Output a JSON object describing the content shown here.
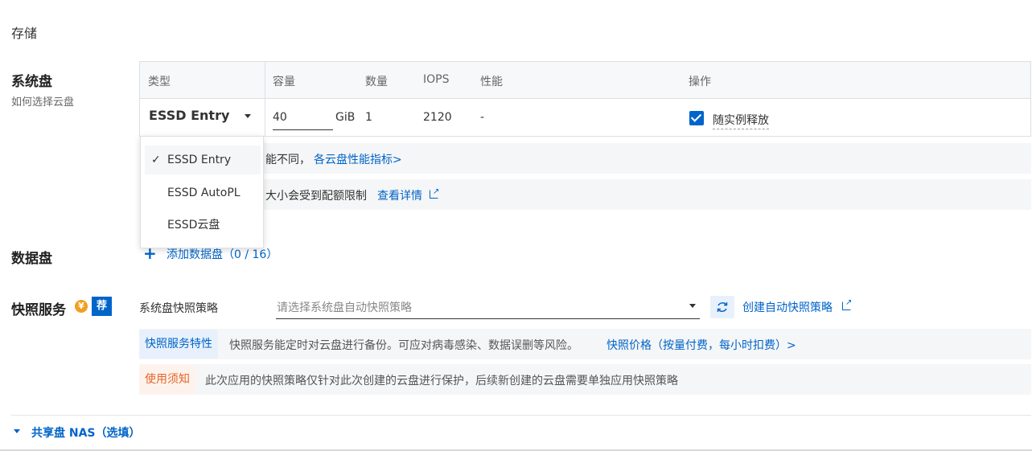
{
  "page": {
    "section_label": "存储"
  },
  "system_disk": {
    "title": "系统盘",
    "help_link": "如何选择云盘",
    "table": {
      "headers": [
        "类型",
        "容量",
        "数量",
        "IOPS",
        "性能",
        "操作"
      ],
      "row": {
        "type": "ESSD Entry",
        "capacity": "40",
        "capacity_unit": "GiB",
        "quantity": "1",
        "iops": "2120",
        "performance": "-",
        "release_label": "随实例释放",
        "release_checked": true
      }
    },
    "info1": {
      "text": "能不同，",
      "link": "各云盘性能指标>"
    },
    "info2": {
      "text": "大小会受到配额限制",
      "link": "查看详情"
    },
    "dropdown": {
      "options": [
        "ESSD Entry",
        "ESSD AutoPL",
        "ESSD云盘"
      ],
      "selected_index": 0,
      "check_mark": "✓"
    }
  },
  "data_disk": {
    "title": "数据盘",
    "add_icon": "plus-icon",
    "add_label": "添加数据盘（0 / 16）"
  },
  "snapshot": {
    "title": "快照服务",
    "badge_yen": "¥",
    "badge_rec": "荐",
    "policy_label": "系统盘快照策略",
    "policy_placeholder": "请选择系统盘自动快照策略",
    "refresh_icon": "refresh-icon",
    "create_link": "创建自动快照策略",
    "features_tag": "快照服务特性",
    "features_text": "快照服务能定时对云盘进行备份。可应对病毒感染、数据误删等风险。",
    "features_link": "快照价格（按量付费，每小时扣费）>",
    "notice_tag": "使用须知",
    "notice_text": "此次应用的快照策略仅针对此次创建的云盘进行保护，后续新创建的云盘需要单独应用快照策略"
  },
  "nas": {
    "label": "共享盘 NAS（选填）"
  },
  "colors": {
    "accent": "#0064c8",
    "warning": "#e8642a",
    "warning_bg": "#fdf3ec",
    "info_bg": "#e8f1fb"
  }
}
